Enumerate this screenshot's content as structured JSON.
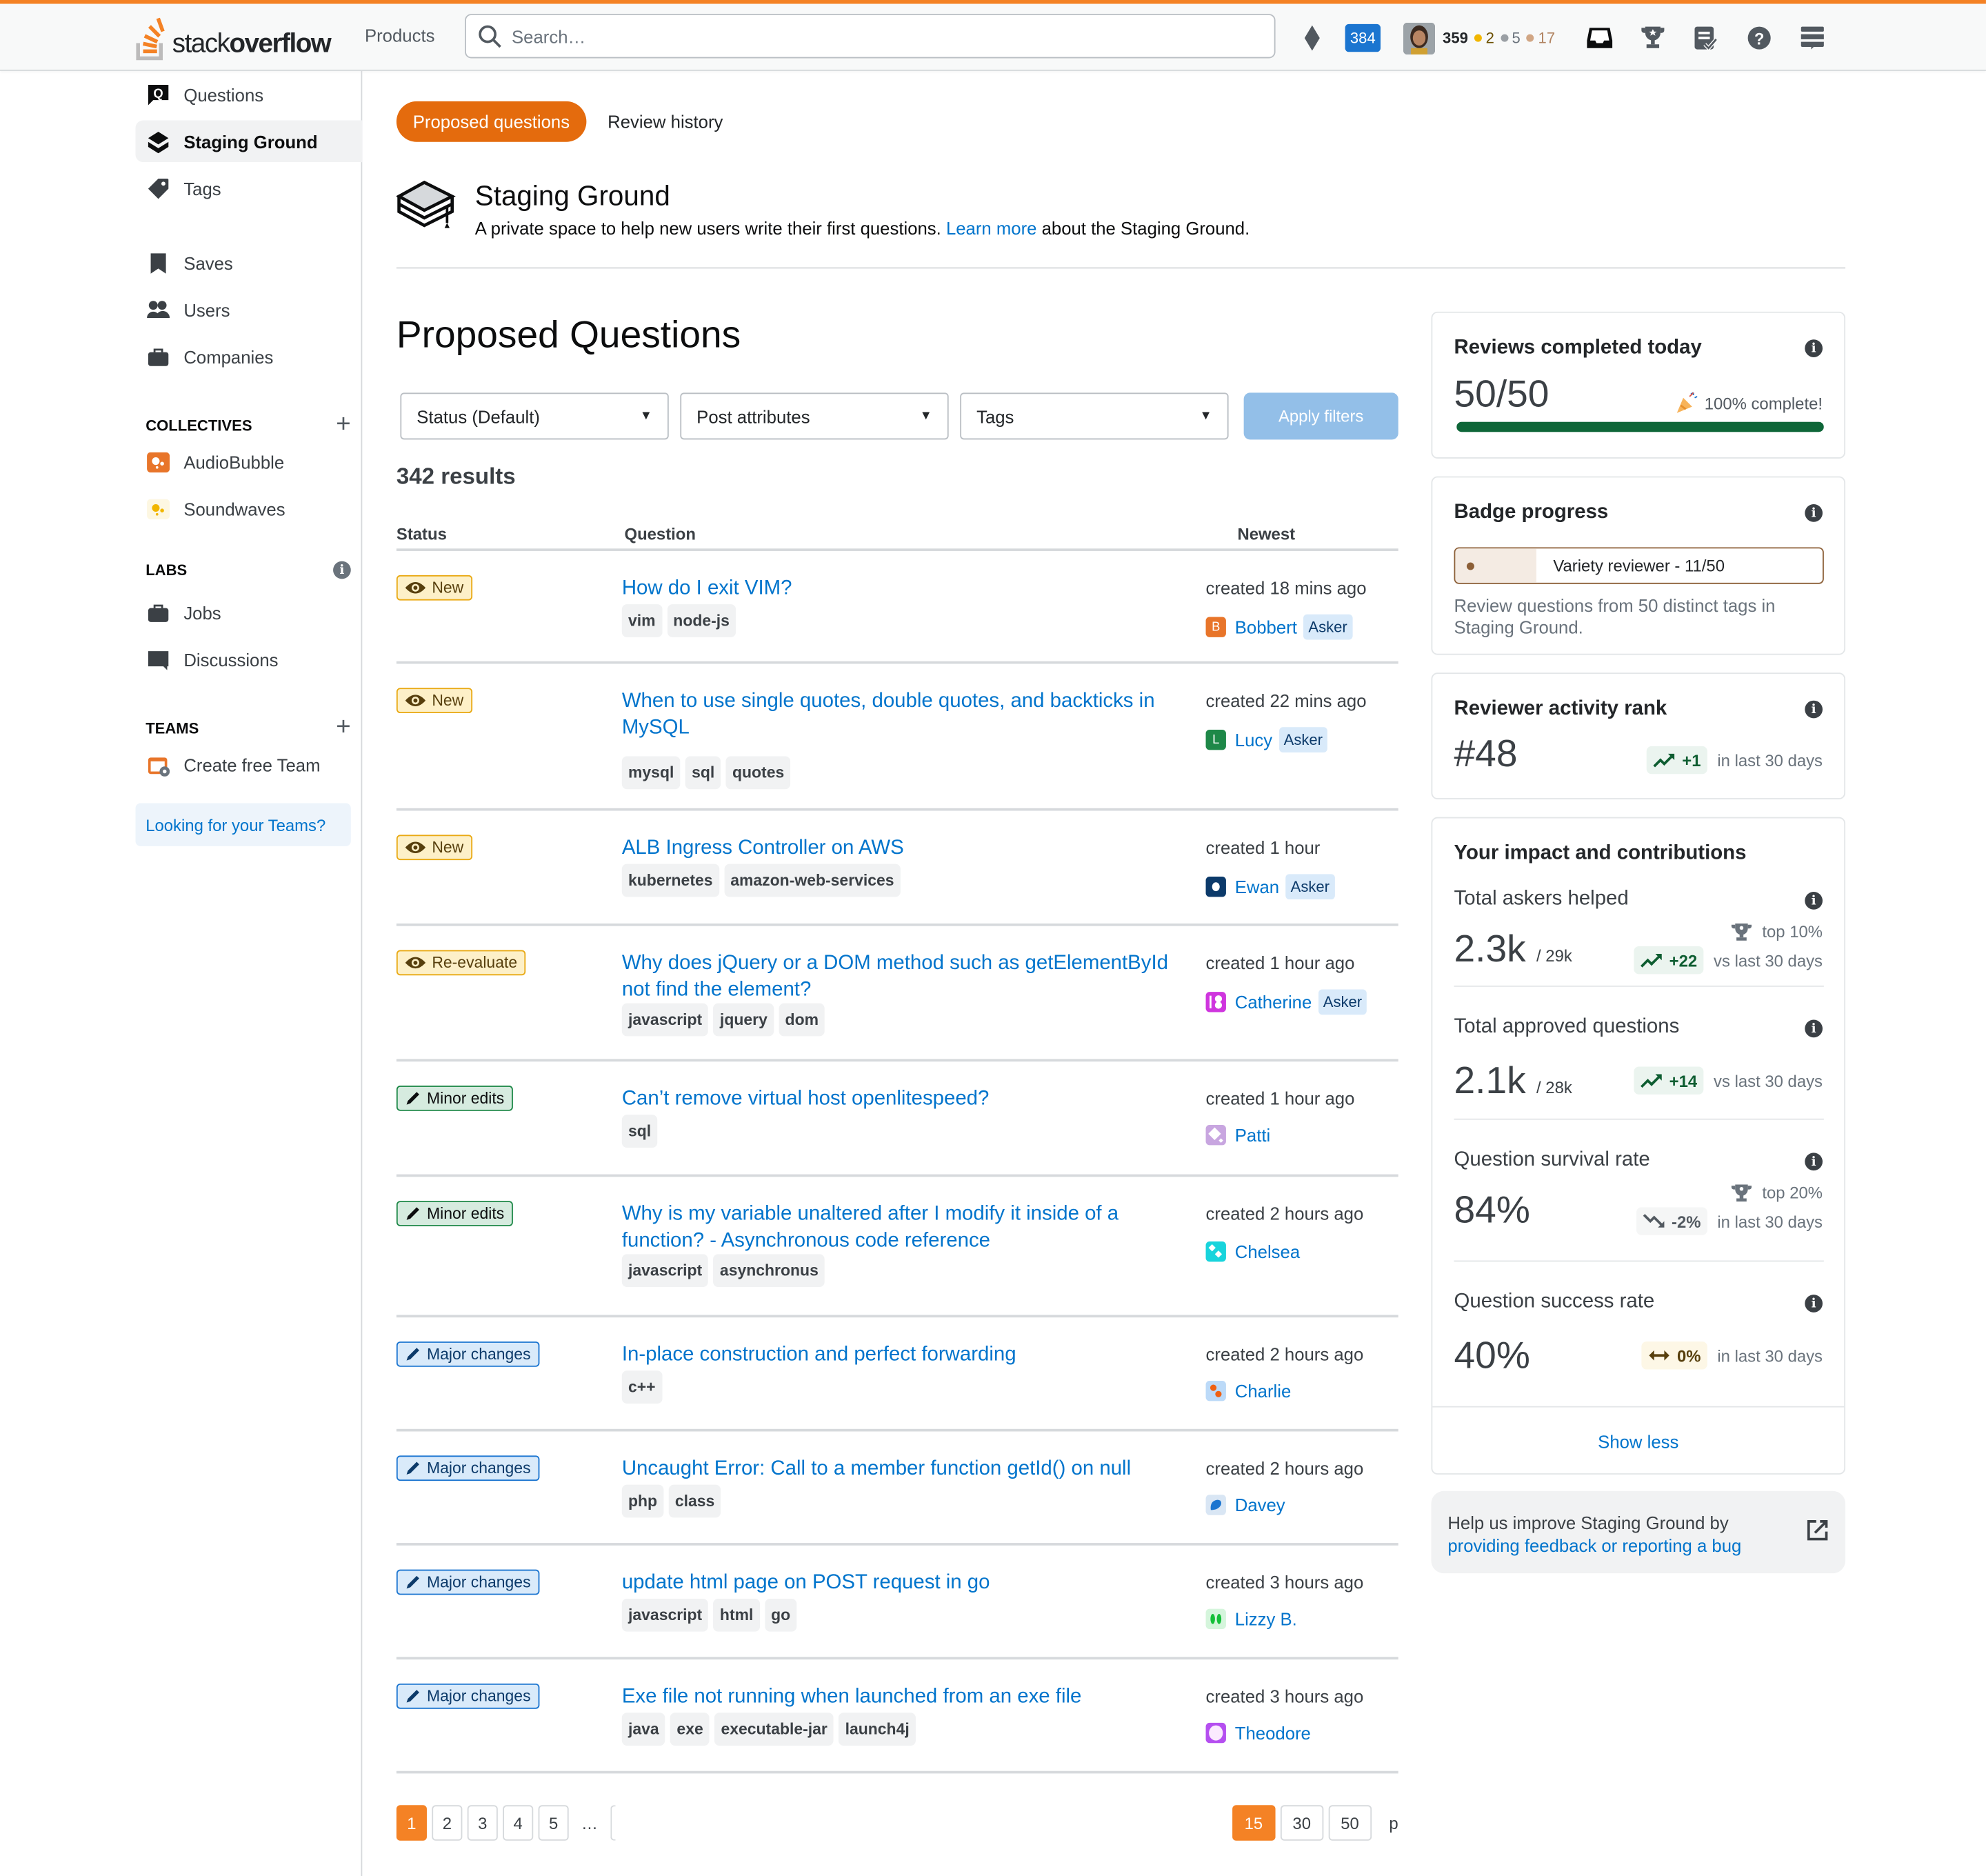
{
  "header": {
    "logo_text_light": "stack",
    "logo_text_bold": "overflow",
    "products_label": "Products",
    "search_placeholder": "Search…",
    "inbox_count": "384",
    "reputation": "359",
    "badges": {
      "gold": "2",
      "silver": "5",
      "bronze": "17"
    },
    "icons": [
      "achievements-diamond-icon",
      "inbox-icon",
      "trophy-icon",
      "review-queue-icon",
      "help-icon",
      "site-switcher-icon"
    ]
  },
  "sidebar": {
    "items": [
      {
        "label": "Questions",
        "icon": "questions-icon"
      },
      {
        "label": "Staging Ground",
        "icon": "staging-ground-icon",
        "active": true
      },
      {
        "label": "Tags",
        "icon": "tag-icon"
      },
      {
        "label": "Saves",
        "icon": "bookmark-icon"
      },
      {
        "label": "Users",
        "icon": "users-icon"
      },
      {
        "label": "Companies",
        "icon": "briefcase-icon"
      }
    ],
    "collectives_heading": "COLLECTIVES",
    "collectives": [
      {
        "label": "AudioBubble",
        "color": "#e8752a"
      },
      {
        "label": "Soundwaves",
        "color": "#f1b600"
      }
    ],
    "labs_heading": "LABS",
    "labs": [
      {
        "label": "Jobs",
        "icon": "briefcase-icon"
      },
      {
        "label": "Discussions",
        "icon": "discussions-icon"
      }
    ],
    "teams_heading": "TEAMS",
    "create_team_label": "Create free Team",
    "looking_for_teams": "Looking for your Teams?"
  },
  "main": {
    "tabs": [
      {
        "label": "Proposed questions",
        "active": true
      },
      {
        "label": "Review history",
        "active": false
      }
    ],
    "sg_title": "Staging Ground",
    "sg_desc_before": "A private space to help new users write their first questions. ",
    "sg_desc_link": "Learn more",
    "sg_desc_after": " about the Staging Ground.",
    "page_title": "Proposed Questions",
    "filters": {
      "status": "Status (Default)",
      "post_attributes": "Post attributes",
      "tags": "Tags",
      "apply": "Apply filters"
    },
    "results_count": "342 results",
    "columns": {
      "status": "Status",
      "question": "Question",
      "newest": "Newest"
    },
    "questions": [
      {
        "status": "New",
        "status_type": "new",
        "title": "How do I exit VIM?",
        "tags": [
          "vim",
          "node-js"
        ],
        "created": "created 18 mins ago",
        "user": "Bobbert",
        "asker": "Asker",
        "avatar_color": "#e8752a",
        "avatar_letter": "B"
      },
      {
        "status": "New",
        "status_type": "new",
        "title": "When to use single quotes, double quotes, and backticks in MySQL",
        "tags": [
          "mysql",
          "sql",
          "quotes"
        ],
        "created": "created 22 mins ago",
        "user": "Lucy",
        "asker": "Asker",
        "avatar_color": "#1e8848",
        "avatar_letter": "L"
      },
      {
        "status": "New",
        "status_type": "new",
        "title": "ALB Ingress Controller on AWS",
        "tags": [
          "kubernetes",
          "amazon-web-services"
        ],
        "created": "created 1 hour",
        "user": "Ewan",
        "asker": "Asker",
        "avatar_color": "#0c3a6a",
        "avatar_letter": ""
      },
      {
        "status": "Re-evaluate",
        "status_type": "new",
        "title": "Why does jQuery or a DOM method such as getElementById not find the element?",
        "tags": [
          "javascript",
          "jquery",
          "dom"
        ],
        "created": "created 1 hour ago",
        "user": "Catherine",
        "asker": "Asker",
        "avatar_color": "#cf35de",
        "avatar_letter": ""
      },
      {
        "status": "Minor edits",
        "status_type": "minor",
        "title": "Can’t remove virtual host openlitespeed?",
        "tags": [
          "sql"
        ],
        "created": "created 1 hour ago",
        "user": "Patti",
        "asker": "",
        "avatar_color": "#c8a6e0",
        "avatar_letter": ""
      },
      {
        "status": "Minor edits",
        "status_type": "minor",
        "title": "Why is my variable unaltered after I modify it inside of a function? -   Asynchronous code reference",
        "tags": [
          "javascript",
          "asynchronus"
        ],
        "created": "created 2 hours ago",
        "user": "Chelsea",
        "asker": "",
        "avatar_color": "#18d4dc",
        "avatar_letter": ""
      },
      {
        "status": "Major changes",
        "status_type": "major",
        "title": "In-place construction and perfect forwarding",
        "tags": [
          "c++"
        ],
        "created": "created 2 hours ago",
        "user": "Charlie",
        "asker": "",
        "avatar_color": "#bcdaf8",
        "avatar_letter": ""
      },
      {
        "status": "Major changes",
        "status_type": "major",
        "title": "Uncaught Error: Call to a member function getId() on null",
        "tags": [
          "php",
          "class"
        ],
        "created": "created 2 hours ago",
        "user": "Davey",
        "asker": "",
        "avatar_color": "#d9e6f4",
        "avatar_letter": ""
      },
      {
        "status": "Major changes",
        "status_type": "major",
        "title": "update html page on POST request in go",
        "tags": [
          "javascript",
          "html",
          "go"
        ],
        "created": "created 3 hours ago",
        "user": "Lizzy B.",
        "asker": "",
        "avatar_color": "#d5f5dc",
        "avatar_letter": ""
      },
      {
        "status": "Major changes",
        "status_type": "major",
        "title": "Exe file not running when launched from an exe file",
        "tags": [
          "java",
          "exe",
          "executable-jar",
          "launch4j"
        ],
        "created": "created 3 hours ago",
        "user": "Theodore",
        "asker": "",
        "avatar_color": "#b54ff0",
        "avatar_letter": ""
      }
    ],
    "pagination": {
      "pages": [
        "1",
        "2",
        "3",
        "4",
        "5"
      ],
      "current": "1",
      "ellipsis": "…"
    },
    "page_sizes": {
      "sizes": [
        "15",
        "30",
        "50"
      ],
      "current": "15",
      "trailing": "p"
    }
  },
  "right": {
    "reviews": {
      "title": "Reviews completed today",
      "value": "50/50",
      "complete_text": "100% complete!",
      "progress": 1.0
    },
    "badge": {
      "title": "Badge progress",
      "badge_label": "Variety reviewer - 11/50",
      "progress": 0.22,
      "desc": "Review questions from 50 distinct tags in Staging Ground."
    },
    "rank": {
      "title": "Reviewer activity rank",
      "value": "#48",
      "delta": "+1",
      "delta_suffix": "in last 30 days"
    },
    "impact": {
      "title": "Your impact and contributions",
      "metrics": [
        {
          "label": "Total askers helped",
          "value": "2.3k",
          "of": "/ 29k",
          "top": "top 10%",
          "delta": "+22",
          "delta_type": "up",
          "suffix": "vs last 30 days"
        },
        {
          "label": "Total approved questions",
          "value": "2.1k",
          "of": "/ 28k",
          "top": "",
          "delta": "+14",
          "delta_type": "up",
          "suffix": "vs last 30 days"
        },
        {
          "label": "Question survival rate",
          "value": "84%",
          "of": "",
          "top": "top 20%",
          "delta": "-2%",
          "delta_type": "down",
          "suffix": "in last 30 days"
        },
        {
          "label": "Question success rate",
          "value": "40%",
          "of": "",
          "top": "",
          "delta": "0%",
          "delta_type": "flat",
          "suffix": "in last 30 days"
        }
      ],
      "show_less": "Show less"
    },
    "feedback": {
      "text": "Help us improve Staging Ground by ",
      "link": "providing feedback or reporting a bug"
    }
  }
}
